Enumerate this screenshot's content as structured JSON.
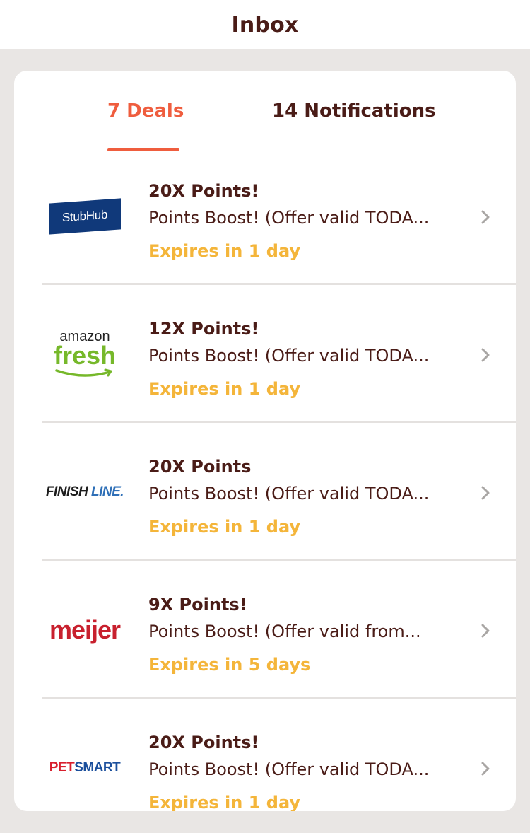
{
  "header": {
    "title": "Inbox"
  },
  "tabs": {
    "deals": "7 Deals",
    "notifications": "14 Notifications"
  },
  "deals": [
    {
      "logo_text": "StubHub",
      "points": "20X Points!",
      "description": "Points Boost! (Offer valid TODA...",
      "expires": "Expires in 1 day"
    },
    {
      "logo_top": "amazon",
      "logo_bottom": "fresh",
      "points": "12X Points!",
      "description": "Points Boost! (Offer valid TODA...",
      "expires": "Expires in 1 day"
    },
    {
      "logo_a": "FINISH",
      "logo_b": " LINE.",
      "points": "20X Points",
      "description": "Points Boost! (Offer valid TODA...",
      "expires": "Expires in 1 day"
    },
    {
      "logo_text": "meijer",
      "points": "9X Points!",
      "description": "Points Boost! (Offer valid from...",
      "expires": "Expires in 5 days"
    },
    {
      "logo_a": "PET",
      "logo_b": "SMART",
      "points": "20X Points!",
      "description": "Points Boost! (Offer valid TODA...",
      "expires": "Expires in 1 day"
    }
  ],
  "colors": {
    "accent": "#ef5d3e",
    "dark_text": "#4a1c17",
    "expires": "#f4b53a",
    "background": "#e9e6e4"
  }
}
